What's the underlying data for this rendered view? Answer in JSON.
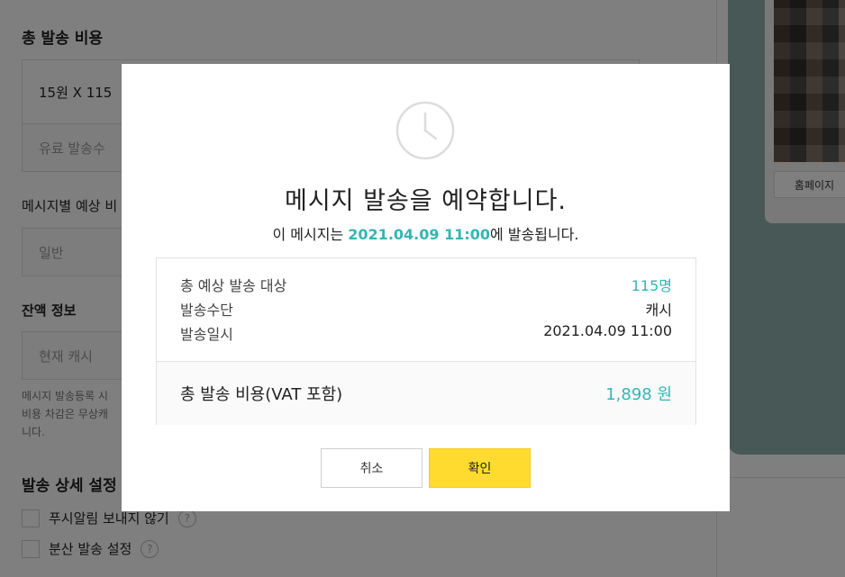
{
  "background": {
    "total_cost_title": "총 발송 비용",
    "cost_formula": "15원 X 115",
    "paid_count_placeholder": "유료 발송수",
    "per_message_label": "메시지별 예상 비",
    "normal_option": "일반",
    "balance_title": "잔액 정보",
    "current_cash": "현재 캐시",
    "note_lines": [
      "메시지 발송등록 시",
      "비용 차감은 무상캐",
      "니다."
    ],
    "detail_title": "발송 상세 설정",
    "push_option": "푸시알림 보내지 않기",
    "split_option": "분산 발송 설정",
    "help_glyph": "?",
    "home_button": "홈페이지"
  },
  "modal": {
    "title": "메시지 발송을 예약합니다.",
    "subtitle_prefix": "이 메시지는 ",
    "subtitle_datetime": "2021.04.09 11:00",
    "subtitle_suffix": "에 발송됩니다.",
    "rows": [
      {
        "label": "총 예상 발송 대상",
        "value": "115명"
      },
      {
        "label": "발송수단",
        "value": "캐시"
      },
      {
        "label": "발송일시",
        "value": "2021.04.09 11:00"
      }
    ],
    "total_label": "총 발송 비용(VAT 포함)",
    "total_value": "1,898 원",
    "cancel_label": "취소",
    "confirm_label": "확인"
  },
  "colors": {
    "accent_teal": "#35b5b3",
    "confirm_yellow": "#fedb2e",
    "overlay": "rgba(0,0,0,0.5)"
  },
  "icons": {
    "modal_icon": "clock-icon"
  }
}
